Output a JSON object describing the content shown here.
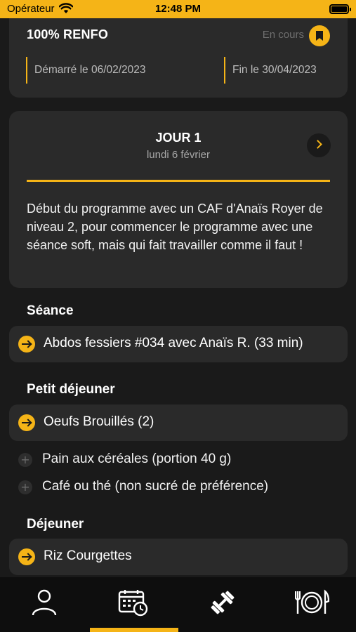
{
  "status_bar": {
    "carrier": "Opérateur",
    "time": "12:48 PM"
  },
  "program": {
    "title": "100% RENFO",
    "status": "En cours",
    "start": "Démarré le 06/02/2023",
    "end": "Fin le 30/04/2023"
  },
  "day": {
    "title": "JOUR 1",
    "date": "lundi 6 février",
    "description": "Début du programme avec un CAF d'Anaïs Royer de niveau 2, pour commencer le programme avec une séance soft, mais qui fait travailler comme il faut !"
  },
  "sections": {
    "session": {
      "title": "Séance",
      "item": "Abdos fessiers #034 avec Anaïs R. (33 min)"
    },
    "breakfast": {
      "title": "Petit déjeuner",
      "item": "Oeufs Brouillés (2)",
      "extras": [
        "Pain aux céréales (portion 40 g)",
        "Café ou thé (non sucré de préférence)"
      ]
    },
    "lunch": {
      "title": "Déjeuner",
      "item": "Riz Courgettes"
    }
  },
  "tabbar": {
    "active_index": 1,
    "tabs": [
      {
        "icon": "profile-icon"
      },
      {
        "icon": "calendar-clock-icon"
      },
      {
        "icon": "dumbbell-icon"
      },
      {
        "icon": "plate-cutlery-icon"
      }
    ]
  },
  "colors": {
    "accent": "#f5b417",
    "background": "#1a1a1a",
    "card": "#2a2a2a",
    "tabbar": "#0e0e0e"
  }
}
